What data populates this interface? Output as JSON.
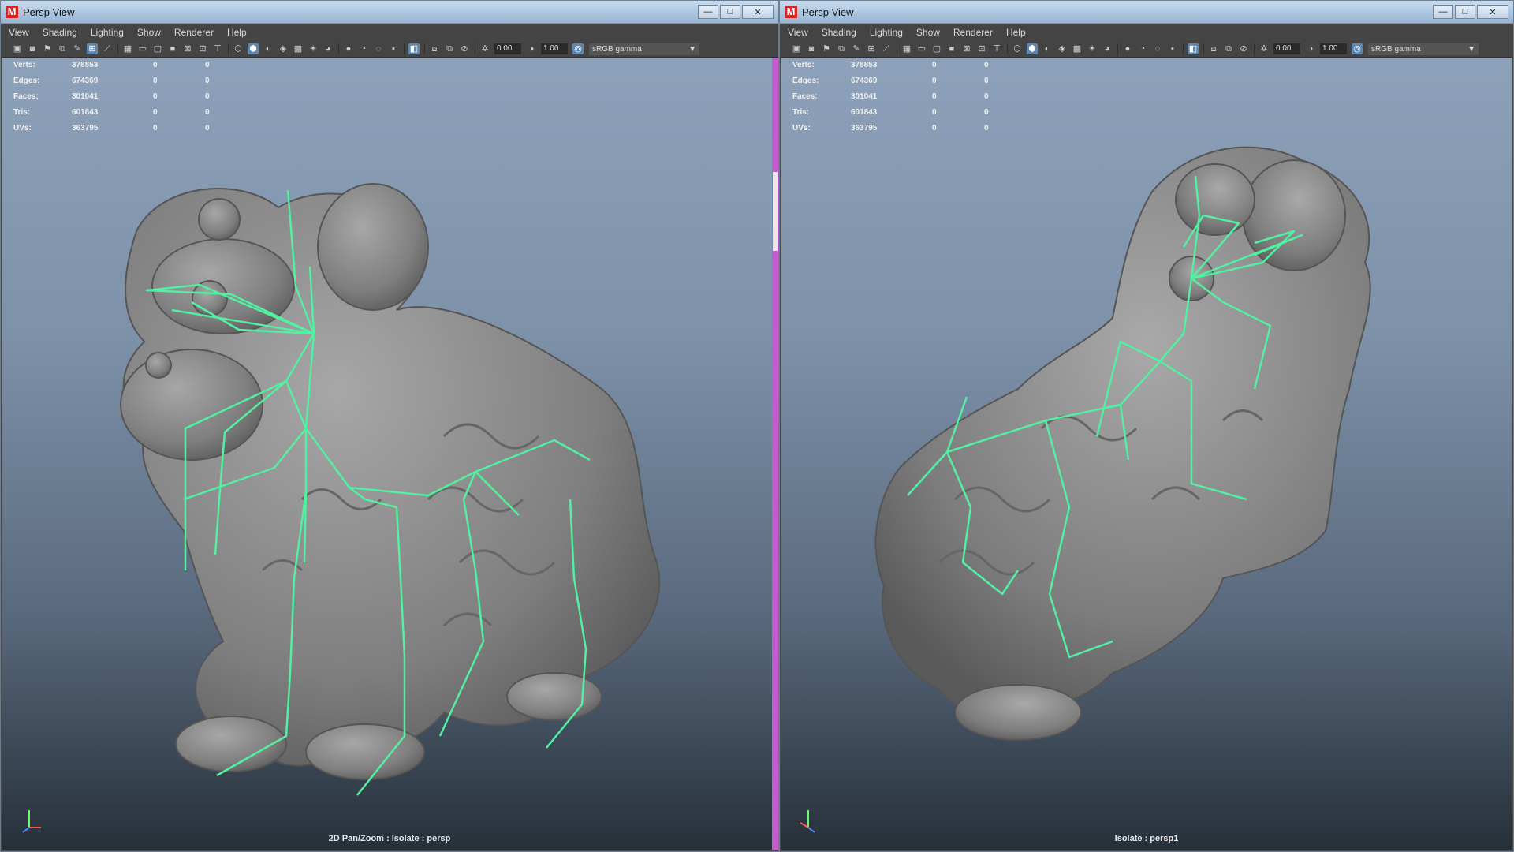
{
  "left": {
    "title": "Persp View",
    "menus": [
      "View",
      "Shading",
      "Lighting",
      "Show",
      "Renderer",
      "Help"
    ],
    "exposure": "0.00",
    "gamma": "1.00",
    "color_space": "sRGB gamma",
    "stats": [
      {
        "label": "Verts:",
        "v1": "378853",
        "v2": "0",
        "v3": "0"
      },
      {
        "label": "Edges:",
        "v1": "674369",
        "v2": "0",
        "v3": "0"
      },
      {
        "label": "Faces:",
        "v1": "301041",
        "v2": "0",
        "v3": "0"
      },
      {
        "label": "Tris:",
        "v1": "601843",
        "v2": "0",
        "v3": "0"
      },
      {
        "label": "UVs:",
        "v1": "363795",
        "v2": "0",
        "v3": "0"
      }
    ],
    "caption": "2D Pan/Zoom : Isolate : persp"
  },
  "right": {
    "title": "Persp View",
    "menus": [
      "View",
      "Shading",
      "Lighting",
      "Show",
      "Renderer",
      "Help"
    ],
    "exposure": "0.00",
    "gamma": "1.00",
    "color_space": "sRGB gamma",
    "stats": [
      {
        "label": "Verts:",
        "v1": "378853",
        "v2": "0",
        "v3": "0"
      },
      {
        "label": "Edges:",
        "v1": "674369",
        "v2": "0",
        "v3": "0"
      },
      {
        "label": "Faces:",
        "v1": "301041",
        "v2": "0",
        "v3": "0"
      },
      {
        "label": "Tris:",
        "v1": "601843",
        "v2": "0",
        "v3": "0"
      },
      {
        "label": "UVs:",
        "v1": "363795",
        "v2": "0",
        "v3": "0"
      }
    ],
    "caption": "Isolate : persp1"
  },
  "window_buttons": {
    "minimize": "—",
    "maximize": "□",
    "close": "✕"
  },
  "colors": {
    "skeleton": "#52f0a0",
    "model": "#8a8a8a",
    "accent": "#5c87b0"
  },
  "icons": [
    "camera-icon",
    "grid-icon",
    "wireframe-icon",
    "smooth-shade-icon",
    "light-icon",
    "isolate-icon",
    "exposure-icon",
    "gamma-icon",
    "colorspace-icon"
  ]
}
